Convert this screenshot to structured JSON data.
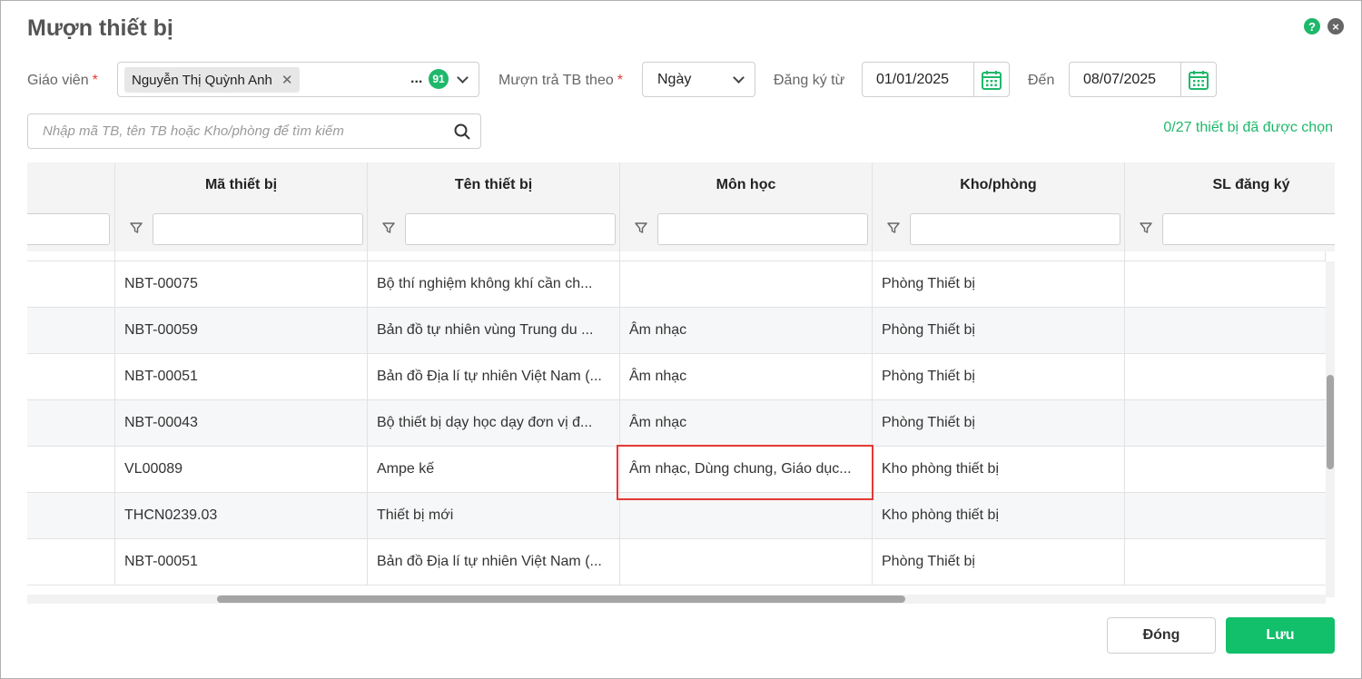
{
  "dialog": {
    "title": "Mượn thiết bị",
    "help_glyph": "?",
    "close_glyph": "×"
  },
  "filters": {
    "teacher_label": "Giáo viên",
    "required_mark": "*",
    "teacher_chip": "Nguyễn Thị Quỳnh Anh",
    "chip_remove_glyph": "✕",
    "more_dots": "...",
    "teacher_count": "91",
    "mode_label": "Mượn trả TB theo",
    "mode_value": "Ngày",
    "from_label": "Đăng ký từ",
    "from_date": "01/01/2025",
    "to_label": "Đến",
    "to_date": "08/07/2025"
  },
  "search": {
    "placeholder": "Nhập mã TB, tên TB hoặc Kho/phòng để tìm kiếm",
    "value": ""
  },
  "selected_status": "0/27 thiết bị đã được chọn",
  "table": {
    "columns": [
      "",
      "Mã thiết bị",
      "Tên thiết bị",
      "Môn học",
      "Kho/phòng",
      "SL đăng ký"
    ],
    "rows": [
      {
        "code": "NBT-00075",
        "name": "Bộ thí nghiệm không khí cần ch...",
        "subject": "",
        "room": "Phòng Thiết bị",
        "qty": ""
      },
      {
        "code": "NBT-00059",
        "name": "Bản đồ tự nhiên vùng Trung du ...",
        "subject": "Âm nhạc",
        "room": "Phòng Thiết bị",
        "qty": ""
      },
      {
        "code": "NBT-00051",
        "name": "Bản đồ Địa lí tự nhiên Việt Nam (...",
        "subject": "Âm nhạc",
        "room": "Phòng Thiết bị",
        "qty": ""
      },
      {
        "code": "NBT-00043",
        "name": "Bộ thiết bị dạy học dạy đơn vị đ...",
        "subject": "Âm nhạc",
        "room": "Phòng Thiết bị",
        "qty": ""
      },
      {
        "code": "VL00089",
        "name": "Ampe kế",
        "subject": "Âm nhạc, Dùng chung, Giáo dục...",
        "room": "Kho phòng thiết bị",
        "qty": ""
      },
      {
        "code": "THCN0239.03",
        "name": "Thiết bị mới",
        "subject": "",
        "room": "Kho phòng thiết bị",
        "qty": ""
      },
      {
        "code": "NBT-00051",
        "name": "Bản đồ Địa lí tự nhiên Việt Nam (...",
        "subject": "",
        "room": "Phòng Thiết bị",
        "qty": ""
      }
    ]
  },
  "buttons": {
    "close": "Đóng",
    "save": "Lưu"
  },
  "colors": {
    "accent": "#12bf6a",
    "highlight": "#e53935"
  }
}
